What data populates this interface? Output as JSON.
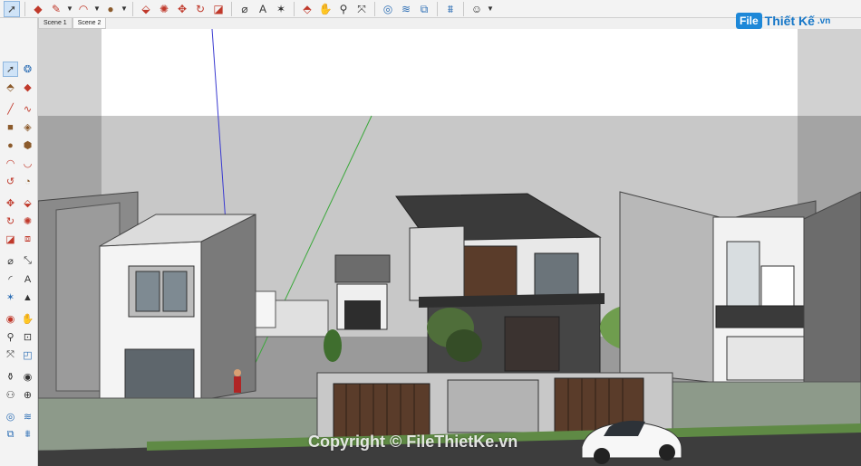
{
  "tabs": [
    {
      "label": "Scene 1"
    },
    {
      "label": "Scene 2"
    }
  ],
  "toolbar_icons": [
    "select-icon",
    "eraser-icon",
    "pencil-icon",
    "arc-icon",
    "shape-icon",
    "push-pull-icon",
    "follow-me-icon",
    "move-icon",
    "rotate-icon",
    "scale-icon",
    "tape-measure-icon",
    "text-icon",
    "paint-bucket-icon",
    "orbit-icon",
    "zoom-icon",
    "zoom-extents-icon",
    "sandbox-icon",
    "section-icon",
    "layers-icon",
    "account-icon"
  ],
  "logo": {
    "mark": "File",
    "text": "Thiết Kế",
    "suffix": ".vn"
  },
  "watermark": "Copyright © FileThietKe.vn",
  "colors": {
    "sky": "#c9c9c9",
    "accent": "#1e88d8",
    "selected": "#cfe3f7"
  }
}
